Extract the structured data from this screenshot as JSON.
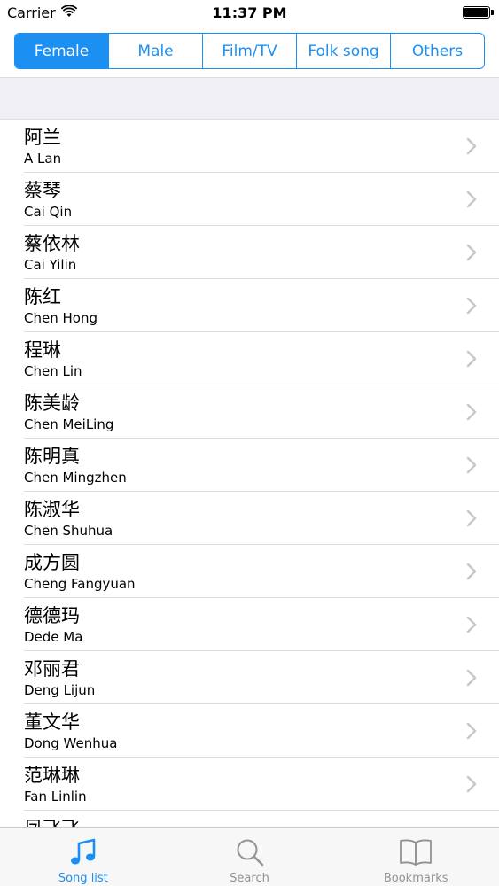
{
  "status_bar": {
    "carrier": "Carrier",
    "time": "11:37 PM"
  },
  "segments": [
    {
      "label": "Female",
      "active": true
    },
    {
      "label": "Male",
      "active": false
    },
    {
      "label": "Film/TV",
      "active": false
    },
    {
      "label": "Folk song",
      "active": false
    },
    {
      "label": "Others",
      "active": false
    }
  ],
  "singers": [
    {
      "chinese": "阿兰",
      "pinyin": "A Lan"
    },
    {
      "chinese": "蔡琴",
      "pinyin": "Cai Qin"
    },
    {
      "chinese": "蔡依林",
      "pinyin": "Cai Yilin"
    },
    {
      "chinese": "陈红",
      "pinyin": "Chen Hong"
    },
    {
      "chinese": "程琳",
      "pinyin": "Chen Lin"
    },
    {
      "chinese": "陈美龄",
      "pinyin": "Chen MeiLing"
    },
    {
      "chinese": "陈明真",
      "pinyin": "Chen Mingzhen"
    },
    {
      "chinese": "陈淑华",
      "pinyin": "Chen Shuhua"
    },
    {
      "chinese": "成方圆",
      "pinyin": "Cheng Fangyuan"
    },
    {
      "chinese": "德德玛",
      "pinyin": "Dede Ma"
    },
    {
      "chinese": "邓丽君",
      "pinyin": "Deng Lijun"
    },
    {
      "chinese": "董文华",
      "pinyin": "Dong Wenhua"
    },
    {
      "chinese": "范琳琳",
      "pinyin": "Fan Linlin"
    },
    {
      "chinese": "凤飞飞",
      "pinyin": ""
    }
  ],
  "tab_bar": {
    "tabs": [
      {
        "label": "Song list",
        "icon": "music-note-icon",
        "active": true
      },
      {
        "label": "Search",
        "icon": "search-icon",
        "active": false
      },
      {
        "label": "Bookmarks",
        "icon": "book-icon",
        "active": false
      }
    ]
  },
  "colors": {
    "accent": "#1b8ff2",
    "inactive_tab": "#929292",
    "band": "#efeff4"
  }
}
